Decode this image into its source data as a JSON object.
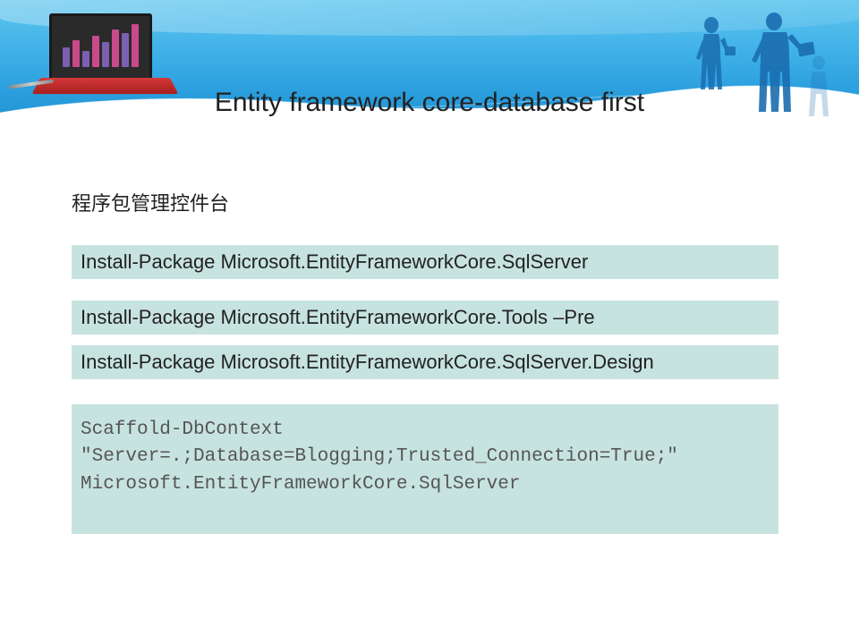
{
  "title": "Entity framework core-database first",
  "subtitle": "程序包管理控件台",
  "commands": {
    "cmd1": "Install-Package Microsoft.EntityFrameworkCore.SqlServer",
    "cmd2": "Install-Package Microsoft.EntityFrameworkCore.Tools –Pre",
    "cmd3": "Install-Package Microsoft.EntityFrameworkCore.SqlServer.Design"
  },
  "code": {
    "line1": "Scaffold-DbContext",
    "line2": "\"Server=.;Database=Blogging;Trusted_Connection=True;\"",
    "line3": "Microsoft.EntityFrameworkCore.SqlServer"
  },
  "colors": {
    "boxBg": "#c7e3e0",
    "headerGradientTop": "#5ec5ee",
    "headerGradientBottom": "#1e8fd0"
  }
}
